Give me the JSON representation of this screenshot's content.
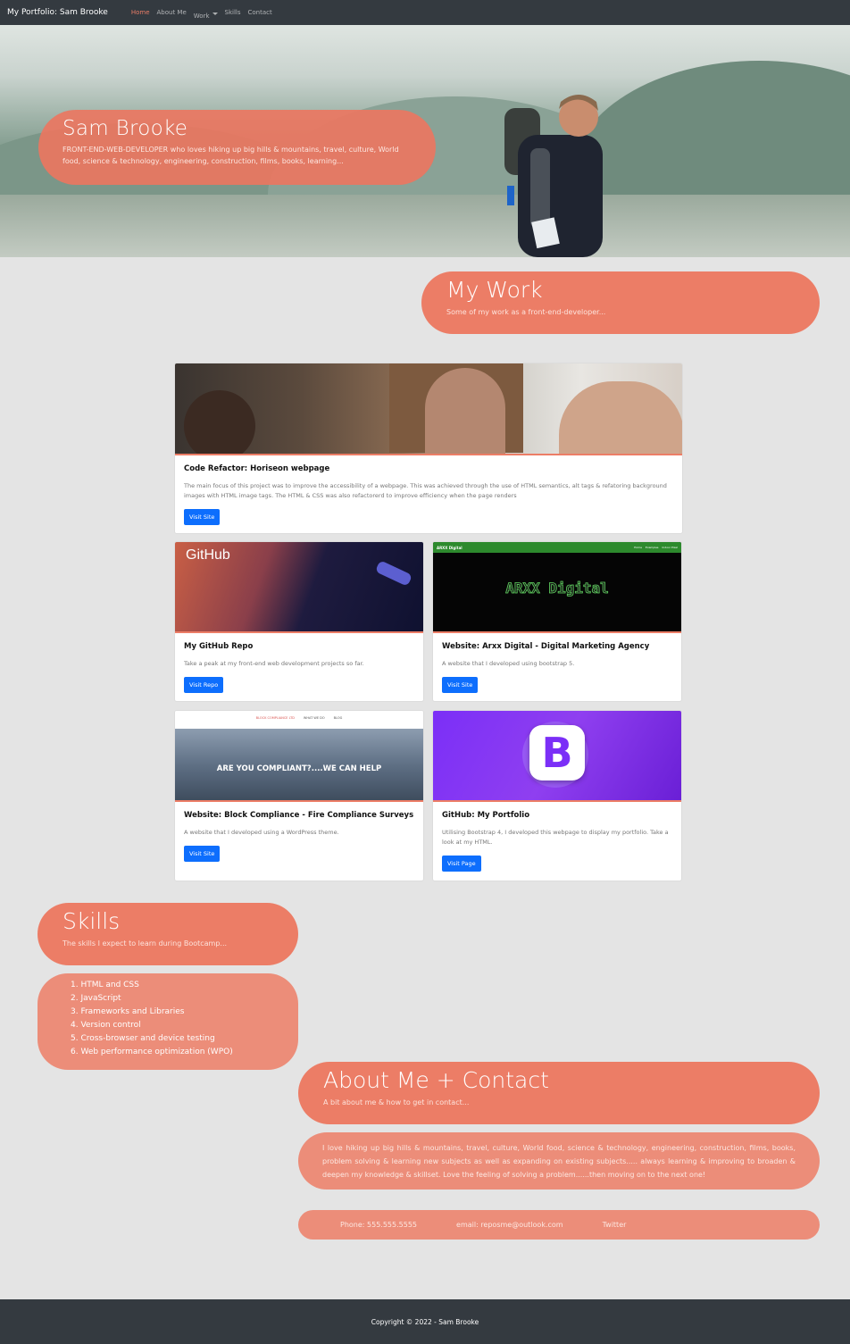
{
  "nav": {
    "brand": "My Portfolio: Sam Brooke",
    "links": [
      "Home",
      "About Me",
      "Work",
      "Skills",
      "Contact"
    ]
  },
  "hero": {
    "title": "Sam Brooke",
    "subtitle": "FRONT-END-WEB-DEVELOPER who loves hiking up big hills & mountains, travel, culture, World food, science & technology, engineering, construction, films, books, learning..."
  },
  "work": {
    "title": "My Work",
    "subtitle": "Some of my work as a front-end-developer..."
  },
  "cards": [
    {
      "title_bold": "Code Refactor:",
      "title_rest": " Horiseon webpage",
      "text": "The main focus of this project was to improve the accessibility of a webpage. This was achieved through the use of HTML semantics, alt tags & refatoring background images with HTML image tags. The HTML & CSS was also refactorerd to improve efficiency when the page renders",
      "button": "Visit Site"
    },
    {
      "title_bold": "My GitHub Repo",
      "title_rest": "",
      "text": "Take a peak at my front-end web development projects so far.",
      "button": "Visit Repo",
      "image_text": "GitHub"
    },
    {
      "title_bold": "Website:",
      "title_rest": " Arxx Digital - Digital Marketing Agency",
      "text": "A website that I developed using bootstrap 5.",
      "button": "Visit Site",
      "image_text": "ARXX Digital",
      "image_nav_brand": "ARXX Digital",
      "image_nav_links": [
        "Home",
        "Examples",
        "Indoor Pixel"
      ]
    },
    {
      "title_bold": "Website:",
      "title_rest": " Block Compliance - Fire Compliance Surveys",
      "text": "A website that I developed using a WordPress theme.",
      "button": "Visit Site",
      "image_text": "ARE YOU COMPLIANT?....WE CAN HELP",
      "image_nav_links": [
        "BLOCK COMPLIANCE LTD",
        "WHAT WE DO",
        "BLOG"
      ]
    },
    {
      "title_bold": "GitHub:",
      "title_rest": " My Portfolio",
      "text": "Utilising Bootstrap 4, I developed this webpage to display my portfolio. Take a look at my HTML.",
      "button": "Visit Page",
      "image_text": "B"
    }
  ],
  "skills": {
    "title": "Skills",
    "subtitle": "The skills I expect to learn during Bootcamp...",
    "items": [
      "1. HTML and CSS",
      "2. JavaScript",
      "3. Frameworks and Libraries",
      "4. Version control",
      "5. Cross-browser and device testing",
      "6. Web performance optimization (WPO)"
    ]
  },
  "about": {
    "title": "About Me + Contact",
    "subtitle": "A bit about me & how to get in contact...",
    "text": "I love hiking up big hills & mountains, travel, culture, World food, science & technology, engineering, construction, films, books, problem solving & learning new subjects as well as expanding on existing subjects..... always learning & improving to broaden & deepen my knowledge & skillset. Love the feeling of solving a problem......then moving on to the next one!"
  },
  "contact": {
    "phone": "Phone: 555.555.5555",
    "email": "email: reposme@outlook.com",
    "twitter": "Twitter"
  },
  "footer": {
    "text": "Copyright © 2022 - Sam Brooke"
  },
  "colors": {
    "accent": "#ec7d66",
    "navbar": "#343a40",
    "button": "#0d6efd",
    "background": "#e4e4e4"
  }
}
